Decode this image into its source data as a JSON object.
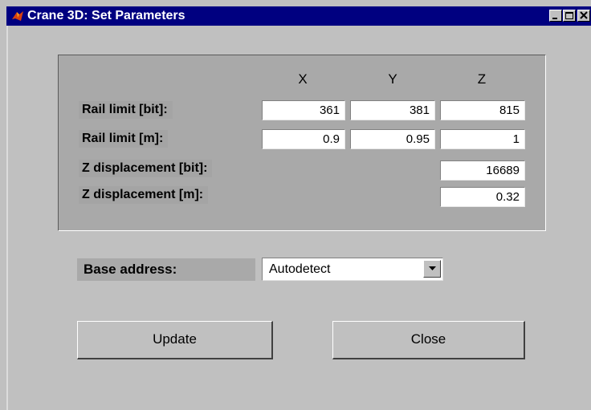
{
  "window": {
    "title": "Crane 3D: Set Parameters",
    "controls": [
      "minimize-icon",
      "maximize-icon",
      "close-icon"
    ]
  },
  "table": {
    "columns": [
      "X",
      "Y",
      "Z"
    ],
    "rows": [
      {
        "label": "Rail limit [bit]:",
        "x": "361",
        "y": "381",
        "z": "815"
      },
      {
        "label": "Rail limit [m]:",
        "x": "0.9",
        "y": "0.95",
        "z": "1"
      },
      {
        "label": "Z displacement [bit]:",
        "z": "16689"
      },
      {
        "label": "Z displacement [m]:",
        "z": "0.32"
      }
    ]
  },
  "base_address": {
    "label": "Base address:",
    "selected": "Autodetect"
  },
  "buttons": {
    "update": "Update",
    "close": "Close"
  },
  "colors": {
    "titlebar": "#000080",
    "background": "#c0c0c0",
    "panel": "#a9a9a9"
  }
}
